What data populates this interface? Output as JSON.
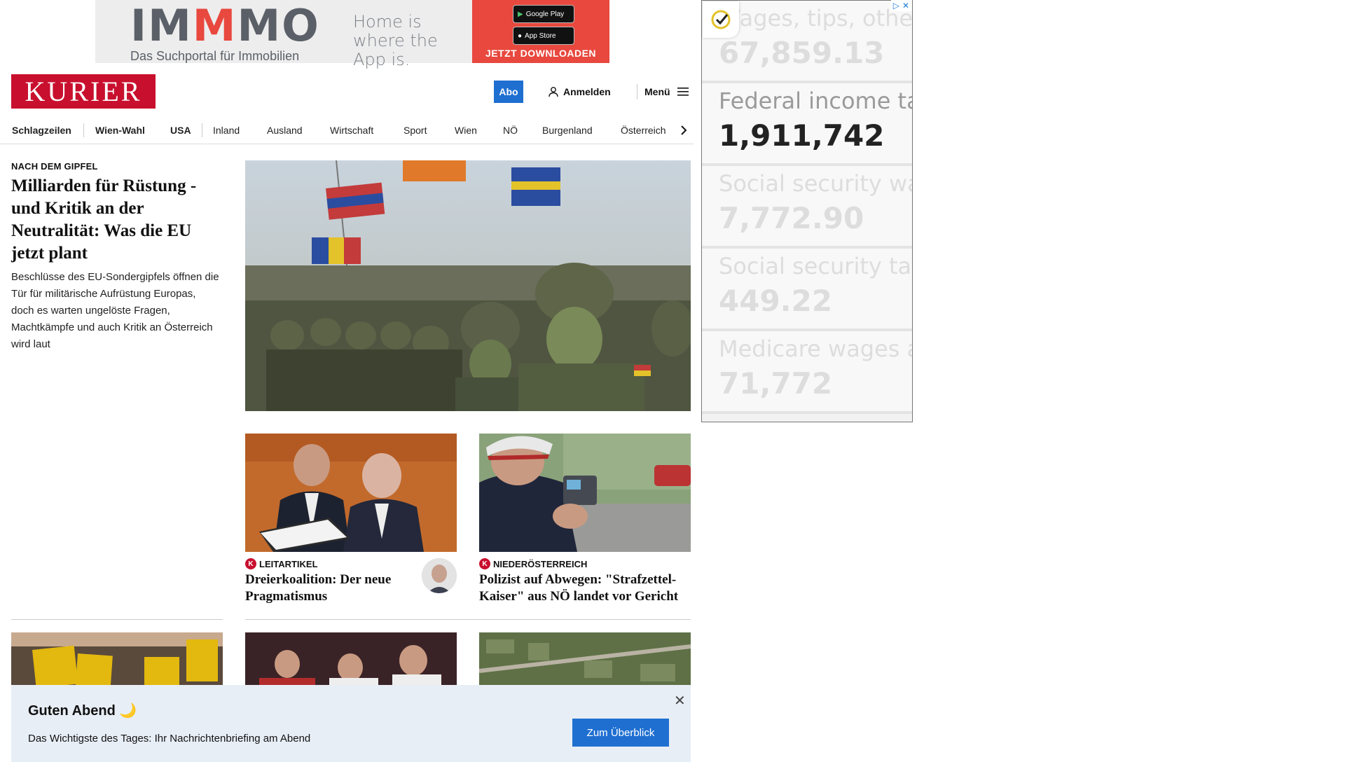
{
  "banner_ad": {
    "logo_part1": "IM",
    "logo_part2": "M",
    "logo_part3": "MO",
    "logo_subtitle": "Das Suchportal für Immobilien",
    "tagline": "Home is where the App is.",
    "google_play_label": "Google Play",
    "app_store_label": "App Store",
    "cta": "JETZT DOWNLOADEN",
    "accent_color": "#e8483e"
  },
  "header": {
    "logo": "KURIER",
    "abo": "Abo",
    "login": "Anmelden",
    "menu": "Menü",
    "brand_color": "#c8102e"
  },
  "nav": {
    "items": [
      "Schlagzeilen",
      "Wien-Wahl",
      "USA",
      "Inland",
      "Ausland",
      "Wirtschaft",
      "Sport",
      "Wien",
      "NÖ",
      "Burgenland",
      "Österreich"
    ]
  },
  "lead": {
    "kicker": "NACH DEM GIPFEL",
    "title": "Milliarden für Rüstung - und Kritik an der Neutralität: Was die EU jetzt plant",
    "teaser": "Beschlüsse des EU-Sondergipfels öffnen die Tür für militärische Aufrüstung Europas, doch es warten ungelöste Fragen, Machtkämpfe und auch Kritik an Österreich wird laut"
  },
  "cards": [
    {
      "kicker": "LEITARTIKEL",
      "title": "Dreierkoalition: Der neue Pragmatismus"
    },
    {
      "kicker": "NIEDERÖSTERREICH",
      "title": "Polizist auf Abwegen: \"Strafzettel-Kaiser\" aus NÖ landet vor Gericht"
    }
  ],
  "side_ad": {
    "rows": [
      {
        "label": "Wages, tips, other",
        "value": "67,859.13"
      },
      {
        "label": "Federal income ta",
        "value": "1,911,742"
      },
      {
        "label": "Social security wa",
        "value": "7,772.90"
      },
      {
        "label": "Social security tax",
        "value": "449.22"
      },
      {
        "label": "Medicare wages a",
        "value": "71,772"
      }
    ]
  },
  "notification": {
    "title": "Guten Abend 🌙",
    "text": "Das Wichtigste des Tages: Ihr Nachrichtenbriefing am Abend",
    "button": "Zum Überblick"
  }
}
